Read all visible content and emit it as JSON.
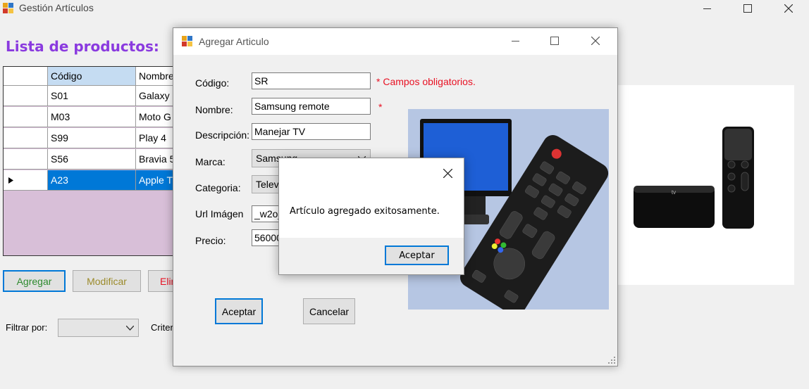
{
  "main_window": {
    "title": "Gestión Artículos",
    "heading": "Lista de productos:",
    "grid": {
      "headers": [
        "",
        "Código",
        "Nombre"
      ],
      "rows": [
        {
          "codigo": "S01",
          "nombre": "Galaxy S"
        },
        {
          "codigo": "M03",
          "nombre": "Moto G"
        },
        {
          "codigo": "S99",
          "nombre": "Play 4"
        },
        {
          "codigo": "S56",
          "nombre": "Bravia 5"
        },
        {
          "codigo": "A23",
          "nombre": "Apple TV",
          "selected": true
        }
      ]
    },
    "buttons": {
      "add": "Agregar",
      "modify": "Modificar",
      "delete": "Elim"
    },
    "filter": {
      "label": "Filtrar por:",
      "value": "",
      "criteria_label": "Criteri"
    }
  },
  "add_dialog": {
    "title": "Agregar Articulo",
    "fields": {
      "codigo": {
        "label": "Código:",
        "value": "SR"
      },
      "nombre": {
        "label": "Nombre:",
        "value": "Samsung remote"
      },
      "descripcion": {
        "label": "Descripción:",
        "value": "Manejar TV"
      },
      "marca": {
        "label": "Marca:",
        "value": "Samsung"
      },
      "categoria": {
        "label": "Categoria:",
        "value": "Telev"
      },
      "url_imagen": {
        "label": "Url Imágen",
        "value": "_w2oj"
      },
      "precio": {
        "label": "Precio:",
        "value": "56000"
      }
    },
    "required_note": "* Campos obligatorios.",
    "required_star": "*",
    "accept": "Aceptar",
    "cancel": "Cancelar"
  },
  "message_box": {
    "text": "Artículo agregado exitosamente.",
    "ok": "Aceptar"
  },
  "colors": {
    "heading": "#8a3adf",
    "selection": "#0078d7",
    "required": "#e81123",
    "grid_bg": "#d8bfd8"
  }
}
